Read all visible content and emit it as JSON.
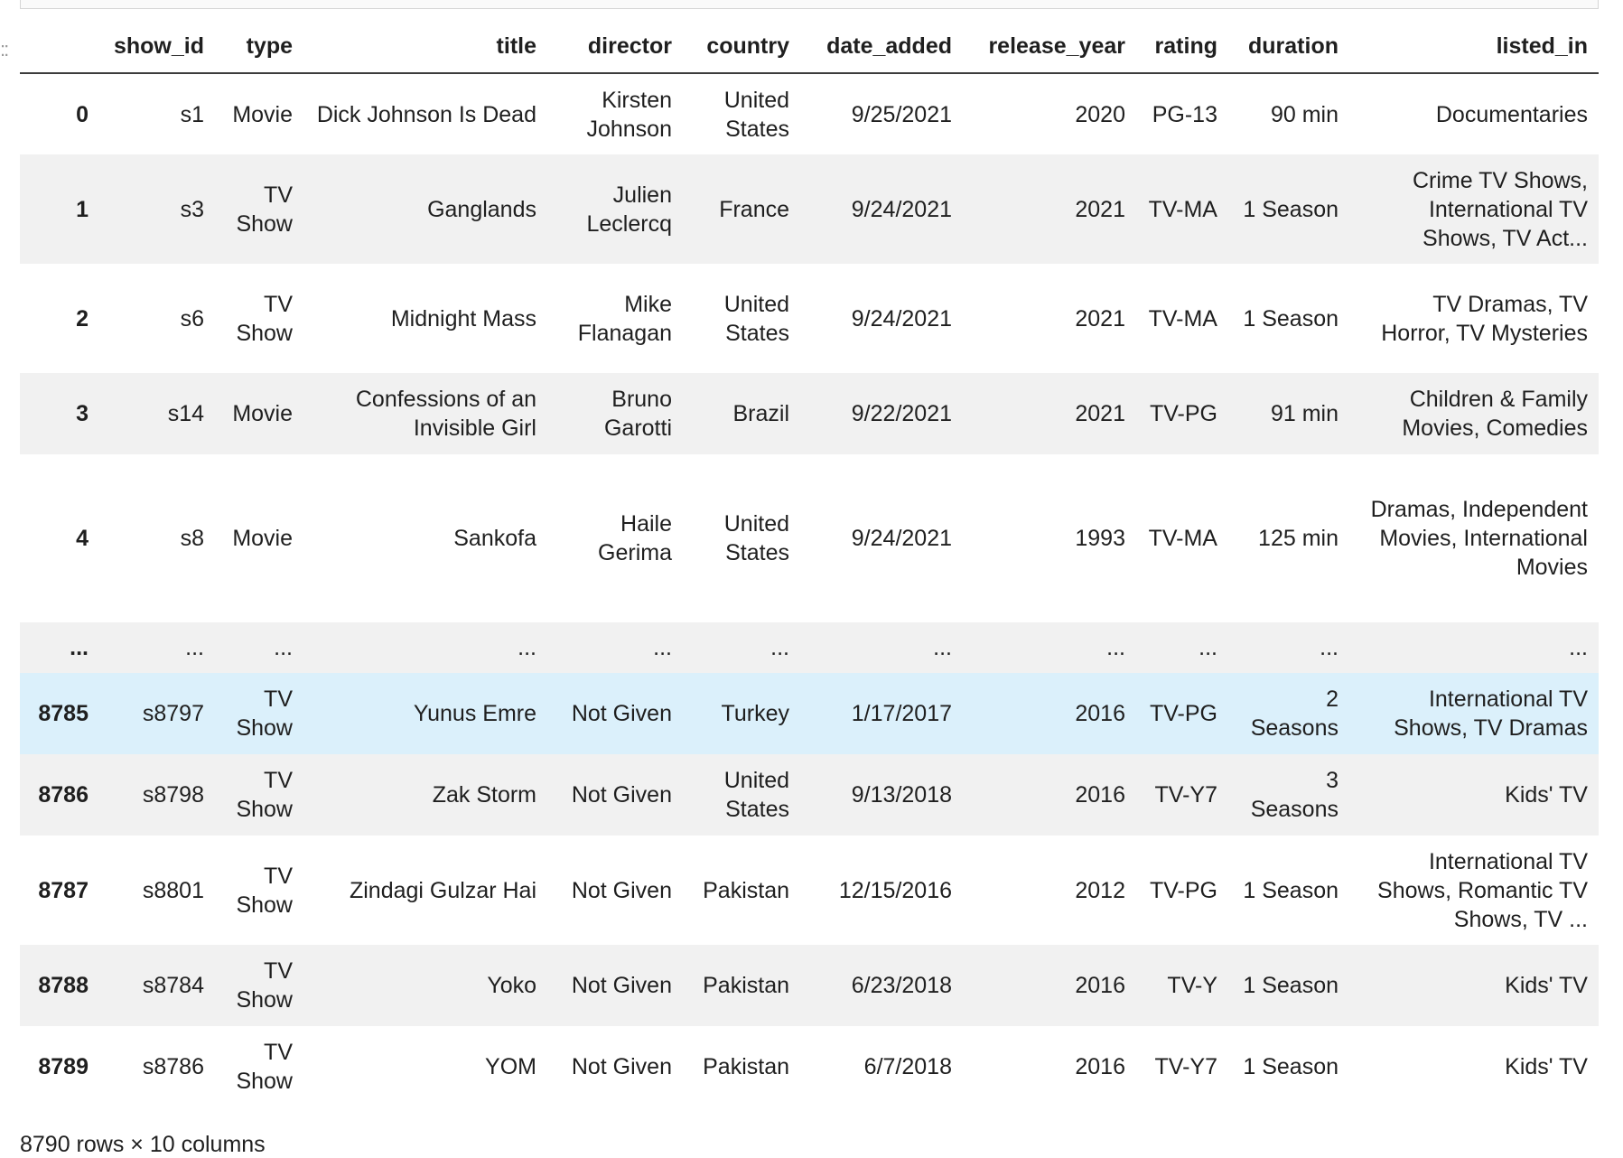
{
  "dataframe": {
    "columns": [
      "show_id",
      "type",
      "title",
      "director",
      "country",
      "date_added",
      "release_year",
      "rating",
      "duration",
      "listed_in"
    ],
    "rows": [
      {
        "index": "0",
        "cells": [
          "s1",
          "Movie",
          "Dick Johnson Is Dead",
          "Kirsten Johnson",
          "United States",
          "9/25/2021",
          "2020",
          "PG-13",
          "90 min",
          "Documentaries"
        ]
      },
      {
        "index": "1",
        "cells": [
          "s3",
          "TV Show",
          "Ganglands",
          "Julien Leclercq",
          "France",
          "9/24/2021",
          "2021",
          "TV-MA",
          "1 Season",
          "Crime TV Shows, International TV Shows, TV Act..."
        ]
      },
      {
        "index": "2",
        "cells": [
          "s6",
          "TV Show",
          "Midnight Mass",
          "Mike Flanagan",
          "United States",
          "9/24/2021",
          "2021",
          "TV-MA",
          "1 Season",
          "TV Dramas, TV Horror, TV Mysteries"
        ]
      },
      {
        "index": "3",
        "cells": [
          "s14",
          "Movie",
          "Confessions of an Invisible Girl",
          "Bruno Garotti",
          "Brazil",
          "9/22/2021",
          "2021",
          "TV-PG",
          "91 min",
          "Children & Family Movies, Comedies"
        ]
      },
      {
        "index": "4",
        "cells": [
          "s8",
          "Movie",
          "Sankofa",
          "Haile Gerima",
          "United States",
          "9/24/2021",
          "1993",
          "TV-MA",
          "125 min",
          "Dramas, Independent Movies, International Movies"
        ]
      },
      {
        "index": "...",
        "cells": [
          "...",
          "...",
          "...",
          "...",
          "...",
          "...",
          "...",
          "...",
          "...",
          "..."
        ]
      },
      {
        "index": "8785",
        "cells": [
          "s8797",
          "TV Show",
          "Yunus Emre",
          "Not Given",
          "Turkey",
          "1/17/2017",
          "2016",
          "TV-PG",
          "2 Seasons",
          "International TV Shows, TV Dramas"
        ],
        "highlighted": true
      },
      {
        "index": "8786",
        "cells": [
          "s8798",
          "TV Show",
          "Zak Storm",
          "Not Given",
          "United States",
          "9/13/2018",
          "2016",
          "TV-Y7",
          "3 Seasons",
          "Kids' TV"
        ]
      },
      {
        "index": "8787",
        "cells": [
          "s8801",
          "TV Show",
          "Zindagi Gulzar Hai",
          "Not Given",
          "Pakistan",
          "12/15/2016",
          "2012",
          "TV-PG",
          "1 Season",
          "International TV Shows, Romantic TV Shows, TV ..."
        ]
      },
      {
        "index": "8788",
        "cells": [
          "s8784",
          "TV Show",
          "Yoko",
          "Not Given",
          "Pakistan",
          "6/23/2018",
          "2016",
          "TV-Y",
          "1 Season",
          "Kids' TV"
        ]
      },
      {
        "index": "8789",
        "cells": [
          "s8786",
          "TV Show",
          "YOM",
          "Not Given",
          "Pakistan",
          "6/7/2018",
          "2016",
          "TV-Y7",
          "1 Season",
          "Kids' TV"
        ]
      }
    ]
  },
  "footer": "8790 rows × 10 columns",
  "colors": {
    "row_alt": "#f1f1f1",
    "row_hover": "#dbf0fb",
    "header_rule": "#3c3c3c"
  }
}
